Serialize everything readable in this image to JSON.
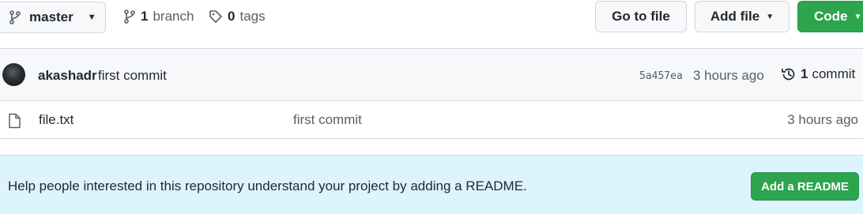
{
  "toolbar": {
    "branch_name": "master",
    "branch_count": "1",
    "branch_label": "branch",
    "tag_count": "0",
    "tag_label": "tags",
    "go_to_file_label": "Go to file",
    "add_file_label": "Add file",
    "code_label": "Code"
  },
  "latest_commit": {
    "author": "akashadr",
    "message": "first commit",
    "sha": "5a457ea",
    "time": "3 hours ago",
    "commit_count": "1",
    "commit_label": "commit"
  },
  "files": [
    {
      "name": "file.txt",
      "message": "first commit",
      "time": "3 hours ago"
    }
  ],
  "readme_banner": {
    "text": "Help people interested in this repository understand your project by adding a README.",
    "button_label": "Add a README"
  },
  "colors": {
    "accent_green": "#2da44e",
    "banner_bg": "#ddf4ff",
    "header_bg": "#f6f8fa",
    "border": "#d0d7de"
  },
  "icons": [
    "git-branch-icon",
    "tag-icon",
    "history-icon",
    "file-icon",
    "caret-down-icon"
  ]
}
